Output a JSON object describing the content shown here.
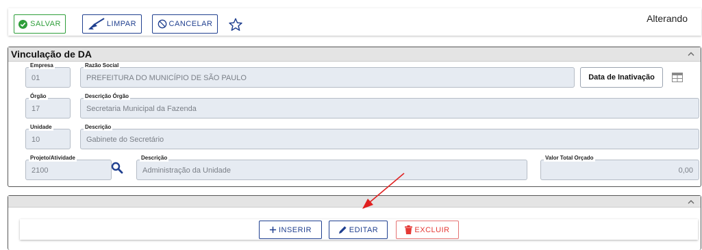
{
  "toolbar": {
    "save_label": "SALVAR",
    "clear_label": "LIMPAR",
    "cancel_label": "CANCELAR",
    "status": "Alterando"
  },
  "panel1": {
    "title": "Vinculação de DA",
    "fields": {
      "empresa": {
        "label": "Empresa",
        "value": "01"
      },
      "razao_social": {
        "label": "Razão Social",
        "value": "PREFEITURA DO MUNICÍPIO DE SÃO PAULO"
      },
      "orgao": {
        "label": "Órgão",
        "value": "17"
      },
      "descricao_orgao": {
        "label": "Descrição Órgão",
        "value": "Secretaria Municipal da Fazenda"
      },
      "unidade": {
        "label": "Unidade",
        "value": "10"
      },
      "descricao_unidade": {
        "label": "Descrição",
        "value": "Gabinete do Secretário"
      },
      "projeto": {
        "label": "Projeto/Atividade",
        "value": "2100"
      },
      "descricao_projeto": {
        "label": "Descrição",
        "value": "Administração da Unidade"
      },
      "valor_total": {
        "label": "Valor Total Orçado",
        "value": "0,00"
      }
    },
    "inactivation_label": "Data de Inativação"
  },
  "actions": {
    "insert_label": "INSERIR",
    "edit_label": "EDITAR",
    "delete_label": "EXCLUIR"
  },
  "colors": {
    "save": "#2e9e3a",
    "primary": "#1f3f8f",
    "danger": "#e53935",
    "field_bg": "#e6ebf2",
    "panel_header": "#e4e4e4",
    "arrow": "#e02020"
  },
  "icons": {
    "save": "check-circle-icon",
    "clear": "broom-icon",
    "cancel": "ban-icon",
    "favorite": "star-icon",
    "collapse": "chevron-up-icon",
    "calendar": "grid-calendar-icon",
    "search": "search-icon",
    "insert": "plus-icon",
    "edit": "pencil-icon",
    "delete": "trash-icon"
  }
}
